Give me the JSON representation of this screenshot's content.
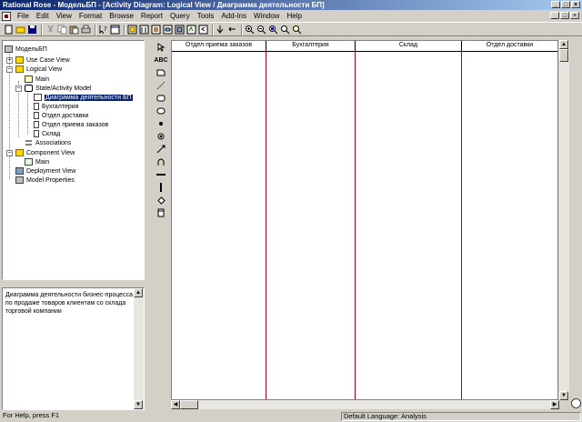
{
  "window": {
    "title": "Rational Rose - МодельБП - [Activity Diagram: Logical View / Диаграмма деятельности БП]"
  },
  "menu": [
    "File",
    "Edit",
    "View",
    "Format",
    "Browse",
    "Report",
    "Query",
    "Tools",
    "Add-Ins",
    "Window",
    "Help"
  ],
  "browser": {
    "nodes": [
      {
        "label": "МодельБП",
        "icon": "model-icon"
      },
      {
        "label": "Use Case View",
        "icon": "folder-icon"
      },
      {
        "label": "Logical View",
        "icon": "folder-icon"
      },
      {
        "label": "Main",
        "icon": "class-diagram-icon"
      },
      {
        "label": "State/Activity Model",
        "icon": "state-model-icon"
      },
      {
        "label": "Диаграмма деятельности БП",
        "icon": "activity-diagram-icon"
      },
      {
        "label": "Бухгалтерия",
        "icon": "swimlane-icon"
      },
      {
        "label": "Отдел доставки",
        "icon": "swimlane-icon"
      },
      {
        "label": "Отдел приема заказов",
        "icon": "swimlane-icon"
      },
      {
        "label": "Склад",
        "icon": "swimlane-icon"
      },
      {
        "label": "Associations",
        "icon": "associations-icon"
      },
      {
        "label": "Component View",
        "icon": "folder-icon"
      },
      {
        "label": "Main",
        "icon": "component-diagram-icon"
      },
      {
        "label": "Deployment View",
        "icon": "deployment-icon"
      },
      {
        "label": "Model Properties",
        "icon": "properties-icon"
      }
    ]
  },
  "documentation": {
    "text": "Диаграмма деятельности бизнес-процесса по продаже товаров клиентам со склада торговой компании"
  },
  "palette": [
    "selection-tool",
    "text-tool",
    "note-tool",
    "anchor-note-tool",
    "state-tool",
    "activity-tool",
    "start-state-tool",
    "end-state-tool",
    "transition-tool",
    "self-transition-tool",
    "horizontal-sync-tool",
    "vertical-sync-tool",
    "decision-tool",
    "swimlane-tool"
  ],
  "diagram": {
    "swimlanes": [
      "Отдел приема заказов",
      "Бухгалтерия",
      "Склад",
      "Отдел доставки"
    ]
  },
  "status": {
    "help": "For Help, press F1",
    "language": "Default Language: Analysis"
  }
}
